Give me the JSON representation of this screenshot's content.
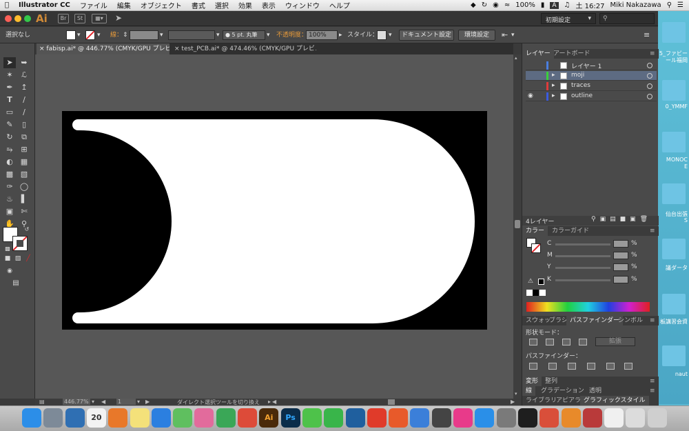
{
  "menubar": {
    "app_name": "Illustrator CC",
    "items": [
      "ファイル",
      "編集",
      "オブジェクト",
      "書式",
      "選択",
      "効果",
      "表示",
      "ウィンドウ",
      "ヘルプ"
    ],
    "battery": "100%",
    "input_indicator": "A",
    "clock": "土 16:27",
    "user": "Miki Nakazawa"
  },
  "titlebar": {
    "app_badge": "Ai",
    "workspace": "初期設定"
  },
  "controlbar": {
    "selection": "選択なし",
    "stroke_label": "線：",
    "brush": "● 5 pt. 丸筆",
    "opacity_label": "不透明度：",
    "opacity_value": "100%",
    "style_label": "スタイル：",
    "doc_setup_button": "ドキュメント設定",
    "prefs_button": "環境設定"
  },
  "tabs": [
    {
      "label": "fabisp.ai* @ 446.77% (CMYK/GPU プレビュー)"
    },
    {
      "label": "test_PCB.ai* @ 474.46% (CMYK/GPU プレビュー)"
    }
  ],
  "statusbar": {
    "zoom": "446.77%",
    "artboard": "1",
    "message": "ダイレクト選択ツールを切り換え"
  },
  "layers_panel": {
    "tab_layers": "レイヤー",
    "tab_artboards": "アートボード",
    "layers": [
      {
        "name": "レイヤー 1",
        "color": "#4a7fe0"
      },
      {
        "name": "moji",
        "color": "#3bcf3b"
      },
      {
        "name": "traces",
        "color": "#e03b3b"
      },
      {
        "name": "outline",
        "color": "#3b5be0"
      }
    ],
    "count": "4レイヤー"
  },
  "color_panel": {
    "tab_color": "カラー",
    "tab_guide": "カラーガイド",
    "channels": [
      {
        "label": "C",
        "unit": "%"
      },
      {
        "label": "M",
        "unit": "%"
      },
      {
        "label": "Y",
        "unit": "%"
      },
      {
        "label": "K",
        "unit": "%"
      }
    ]
  },
  "pathfinder_panel": {
    "tabs": [
      "スウォッ",
      "ブラシ",
      "パスファインダー",
      "シンボル"
    ],
    "shape_modes_label": "形状モード：",
    "expand_button": "拡張",
    "pathfinders_label": "パスファインダー："
  },
  "collapsed_panels": [
    {
      "tabs": [
        "変形",
        "整列"
      ]
    },
    {
      "tabs": [
        "線",
        "グラデーション",
        "透明"
      ]
    },
    {
      "tabs": [
        "ライブラリ",
        "アピアラン",
        "グラフィックスタイル"
      ]
    }
  ],
  "desktop": {
    "labels": [
      "5_ファビー",
      "ール福岡",
      "0_YMMF",
      "MONOC",
      "E",
      "仙台出張",
      "S",
      "議ダータ",
      "板講習会資",
      "naut"
    ]
  },
  "dock": {
    "apps": [
      {
        "name": "finder-icon",
        "label": "",
        "color": "#2c8ee8"
      },
      {
        "name": "launchpad-icon",
        "label": "",
        "color": "#7d8a98"
      },
      {
        "name": "code-editor-icon",
        "label": "",
        "color": "#2f6fb3"
      },
      {
        "name": "calendar-icon",
        "label": "20",
        "color": "#f3f3f3"
      },
      {
        "name": "blender-icon",
        "label": "",
        "color": "#e8782a"
      },
      {
        "name": "notes-icon",
        "label": "",
        "color": "#f4e17a"
      },
      {
        "name": "dropbox-icon",
        "label": "",
        "color": "#2b7fe0"
      },
      {
        "name": "atom-icon",
        "label": "",
        "color": "#5fbf5f"
      },
      {
        "name": "photos-icon",
        "label": "",
        "color": "#e26b9c"
      },
      {
        "name": "drive-icon",
        "label": "",
        "color": "#3aa757"
      },
      {
        "name": "chrome-icon",
        "label": "",
        "color": "#dd4b39"
      },
      {
        "name": "illustrator-icon",
        "label": "Ai",
        "color": "#4a2a0a"
      },
      {
        "name": "photoshop-icon",
        "label": "Ps",
        "color": "#0b2d4a"
      },
      {
        "name": "evernote-icon",
        "label": "",
        "color": "#4ec24a"
      },
      {
        "name": "facetime-icon",
        "label": "",
        "color": "#39b54a"
      },
      {
        "name": "sourcetree-icon",
        "label": "",
        "color": "#1f5f9e"
      },
      {
        "name": "cubicle-icon",
        "label": "",
        "color": "#e03b2a"
      },
      {
        "name": "weibo-icon",
        "label": "",
        "color": "#e85a2a"
      },
      {
        "name": "keynote-icon",
        "label": "",
        "color": "#3b7fd9"
      },
      {
        "name": "inkscape-icon",
        "label": "",
        "color": "#444444"
      },
      {
        "name": "itunes-icon",
        "label": "",
        "color": "#e83a8a"
      },
      {
        "name": "appstore-icon",
        "label": "",
        "color": "#2a8fe8"
      },
      {
        "name": "system-prefs-icon",
        "label": "",
        "color": "#7a7a7a"
      },
      {
        "name": "terminal-icon",
        "label": "",
        "color": "#1e1e1e"
      },
      {
        "name": "grid-app-icon",
        "label": "",
        "color": "#d94f3a"
      },
      {
        "name": "fusion-icon",
        "label": "",
        "color": "#e88a2a"
      },
      {
        "name": "gem-icon",
        "label": "",
        "color": "#b93a3a"
      },
      {
        "name": "document-icon",
        "label": "",
        "color": "#f0f0f0"
      },
      {
        "name": "keyboard-icon",
        "label": "",
        "color": "#dcdcdc"
      },
      {
        "name": "trash-icon",
        "label": "",
        "color": "#cfcfcf"
      }
    ]
  },
  "colors": {
    "ui_dark": "#3a3a3a",
    "panel": "#4a4a4a",
    "canvas": "#575757",
    "artboard_black": "#000000",
    "shape_white": "#ffffff",
    "accent_orange": "#d08a37",
    "selected_row": "#5d6b82"
  }
}
